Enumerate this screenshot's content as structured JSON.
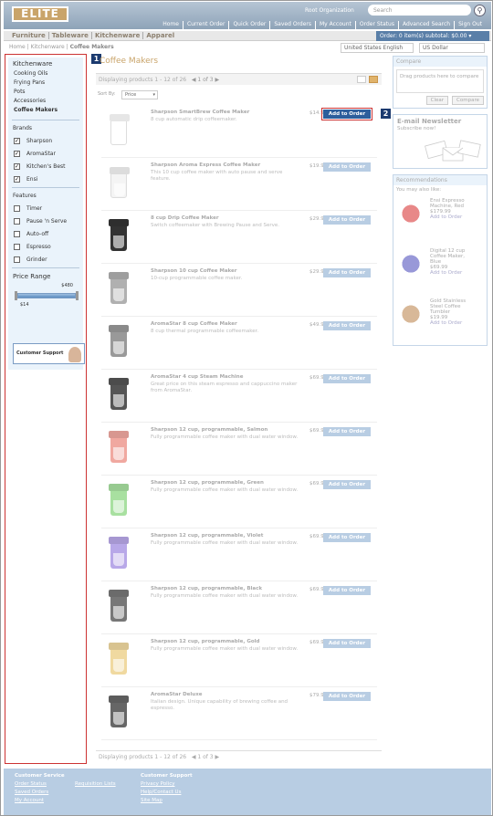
{
  "header": {
    "logo": "ELITE",
    "org": "Root Organization",
    "search_placeholder": "Search",
    "links": [
      "Home",
      "Current Order",
      "Quick Order",
      "Saved Orders",
      "My Account",
      "Order Status",
      "Advanced Search",
      "Sign Out"
    ]
  },
  "nav": {
    "categories": [
      "Furniture",
      "Tableware",
      "Kitchenware",
      "Apparel"
    ],
    "cart": "Order: 0 item(s) subtotal: $0.00"
  },
  "breadcrumb": {
    "home": "Home",
    "section": "Kitchenware",
    "current": "Coffee Makers"
  },
  "locale": {
    "language": "United States English",
    "currency": "US Dollar"
  },
  "sidebar": {
    "category_title": "Kitchenware",
    "category_links": [
      "Cooking Oils",
      "Frying Pans",
      "Pots",
      "Accessories",
      "Coffee Makers"
    ],
    "brands_title": "Brands",
    "brands": [
      {
        "label": "Sharpson",
        "checked": true
      },
      {
        "label": "AromaStar",
        "checked": true
      },
      {
        "label": "Kitchen's Best",
        "checked": true
      },
      {
        "label": "Ensi",
        "checked": true
      }
    ],
    "features_title": "Features",
    "features": [
      {
        "label": "Timer",
        "checked": false
      },
      {
        "label": "Pause 'n Serve",
        "checked": false
      },
      {
        "label": "Auto-off",
        "checked": false
      },
      {
        "label": "Espresso",
        "checked": false
      },
      {
        "label": "Grinder",
        "checked": false
      }
    ],
    "price_title": "Price Range",
    "price_min": "$14",
    "price_max": "$480",
    "support": "Customer Support"
  },
  "markers": {
    "m1": "1",
    "m2": "2"
  },
  "main": {
    "title": "Coffee Makers",
    "display_text": "Displaying products 1 - 12 of 26",
    "pager": "1 of 3",
    "sort_label": "Sort By:",
    "sort_value": "Price",
    "button_label": "Add to Order",
    "products": [
      {
        "name": "Sharpson SmartBrew Coffee Maker",
        "desc": "8 cup automatic drip coffeemaker.",
        "price": "$14.99",
        "color": "#ffffff"
      },
      {
        "name": "Sharpson Aroma Express Coffee Maker",
        "desc": "This 10 cup coffee maker with auto pause and serve feature.",
        "price": "$19.99",
        "color": "#f4f4f4"
      },
      {
        "name": "8 cup Drip Coffee Maker",
        "desc": "Switch coffeemaker with Brewing Pause and Serve.",
        "price": "$29.99",
        "color": "#333333"
      },
      {
        "name": "Sharpson 10 cup Coffee Maker",
        "desc": "10-cup programmable coffee maker.",
        "price": "$29.99",
        "color": "#b0b0b0"
      },
      {
        "name": "AromaStar 8 cup Coffee Maker",
        "desc": "8 cup thermal programmable coffeemaker.",
        "price": "$49.99",
        "color": "#999999"
      },
      {
        "name": "AromaStar 4 cup Steam Machine",
        "desc": "Great price on this steam espresso and cappuccino maker from AromaStar.",
        "price": "$69.99",
        "color": "#555555"
      },
      {
        "name": "Sharpson 12 cup, programmable, Salmon",
        "desc": "Fully programmable coffee maker with dual water window.",
        "price": "$69.99",
        "color": "#f0a8a0"
      },
      {
        "name": "Sharpson 12 cup, programmable, Green",
        "desc": "Fully programmable coffee maker with dual water window.",
        "price": "$69.99",
        "color": "#a8e0a0"
      },
      {
        "name": "Sharpson 12 cup, programmable, Violet",
        "desc": "Fully programmable coffee maker with dual water window.",
        "price": "$69.99",
        "color": "#b8a8e8"
      },
      {
        "name": "Sharpson 12 cup, programmable, Black",
        "desc": "Fully programmable coffee maker with dual water window.",
        "price": "$69.99",
        "color": "#777777"
      },
      {
        "name": "Sharpson 12 cup, programmable, Gold",
        "desc": "Fully programmable coffee maker with dual water window.",
        "price": "$69.99",
        "color": "#f0d9a0"
      },
      {
        "name": "AromaStar Deluxe",
        "desc": "Italian design. Unique capability of brewing coffee and espresso.",
        "price": "$79.99",
        "color": "#666666"
      }
    ]
  },
  "compare": {
    "title": "Compare",
    "placeholder": "Drag products here to compare",
    "clear": "Clear",
    "compare": "Compare"
  },
  "newsletter": {
    "title": "E-mail Newsletter",
    "subtitle": "Subscribe now!"
  },
  "recommendations": {
    "title": "Recommendations",
    "subtitle": "You may also like:",
    "items": [
      {
        "name": "Ensi Espresso Machine, Red",
        "price": "$179.99",
        "add": "Add to Order",
        "color": "#e88888"
      },
      {
        "name": "Digital 12 cup Coffee Maker, Blue",
        "price": "$69.99",
        "add": "Add to Order",
        "color": "#9898d8"
      },
      {
        "name": "Gold Stainless Steel Coffee Tumbler",
        "price": "$19.99",
        "add": "Add to Order",
        "color": "#d8b898"
      }
    ]
  },
  "footer": {
    "service_title": "Customer Service",
    "service_links": [
      "Order Status",
      "Saved Orders",
      "My Account"
    ],
    "requisition": "Requisition Lists",
    "support_title": "Customer Support",
    "support_links": [
      "Privacy Policy",
      "Help/Contact Us",
      "Site Map"
    ]
  }
}
